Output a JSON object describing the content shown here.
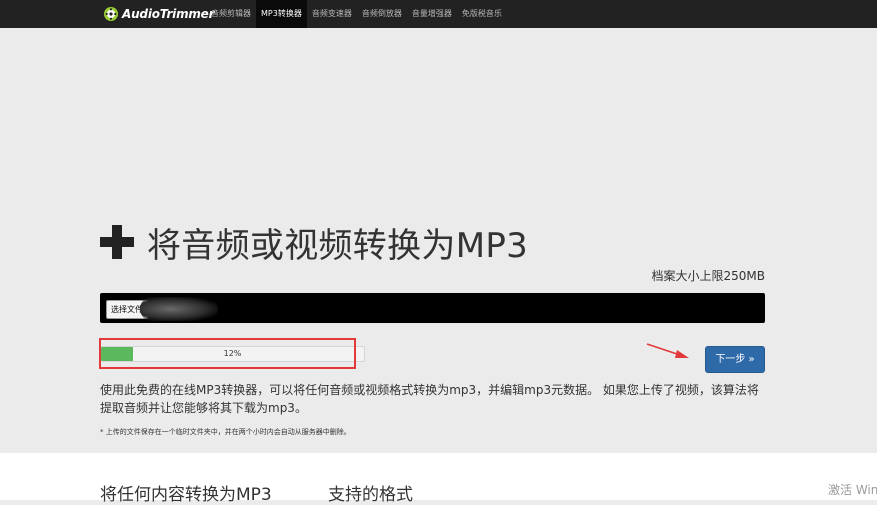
{
  "brand": {
    "name": "AudioTrimmer"
  },
  "nav": {
    "items": [
      {
        "label": "音频剪辑器",
        "active": false
      },
      {
        "label": "MP3转换器",
        "active": true
      },
      {
        "label": "音频变速器",
        "active": false
      },
      {
        "label": "音频倒放器",
        "active": false
      },
      {
        "label": "音量增强器",
        "active": false
      },
      {
        "label": "免版税音乐",
        "active": false
      }
    ]
  },
  "hero": {
    "icon": "plus-icon",
    "title": "将音频或视频转换为MP3",
    "size_limit": "档案大小上限250MB"
  },
  "upload": {
    "choose_file_label": "选择文件"
  },
  "progress": {
    "value_percent": 12,
    "label": "12%"
  },
  "actions": {
    "next_label": "下一步 »"
  },
  "content": {
    "description": "使用此免费的在线MP3转换器，可以将任何音频或视频格式转换为mp3，并编辑mp3元数据。 如果您上传了视频，该算法将提取音频并让您能够将其下载为mp3。",
    "note": "* 上传的文件保存在一个临时文件夹中，并在两个小时内会自动从服务器中删除。"
  },
  "lower": {
    "heading_left": "将任何内容转换为MP3",
    "heading_right": "支持的格式",
    "watermark": "激活 Win"
  },
  "colors": {
    "navbar_bg": "#222222",
    "accent_button": "#2f6aa8",
    "progress_fill": "#5cb85c",
    "annotation_red": "#e23a3a"
  }
}
